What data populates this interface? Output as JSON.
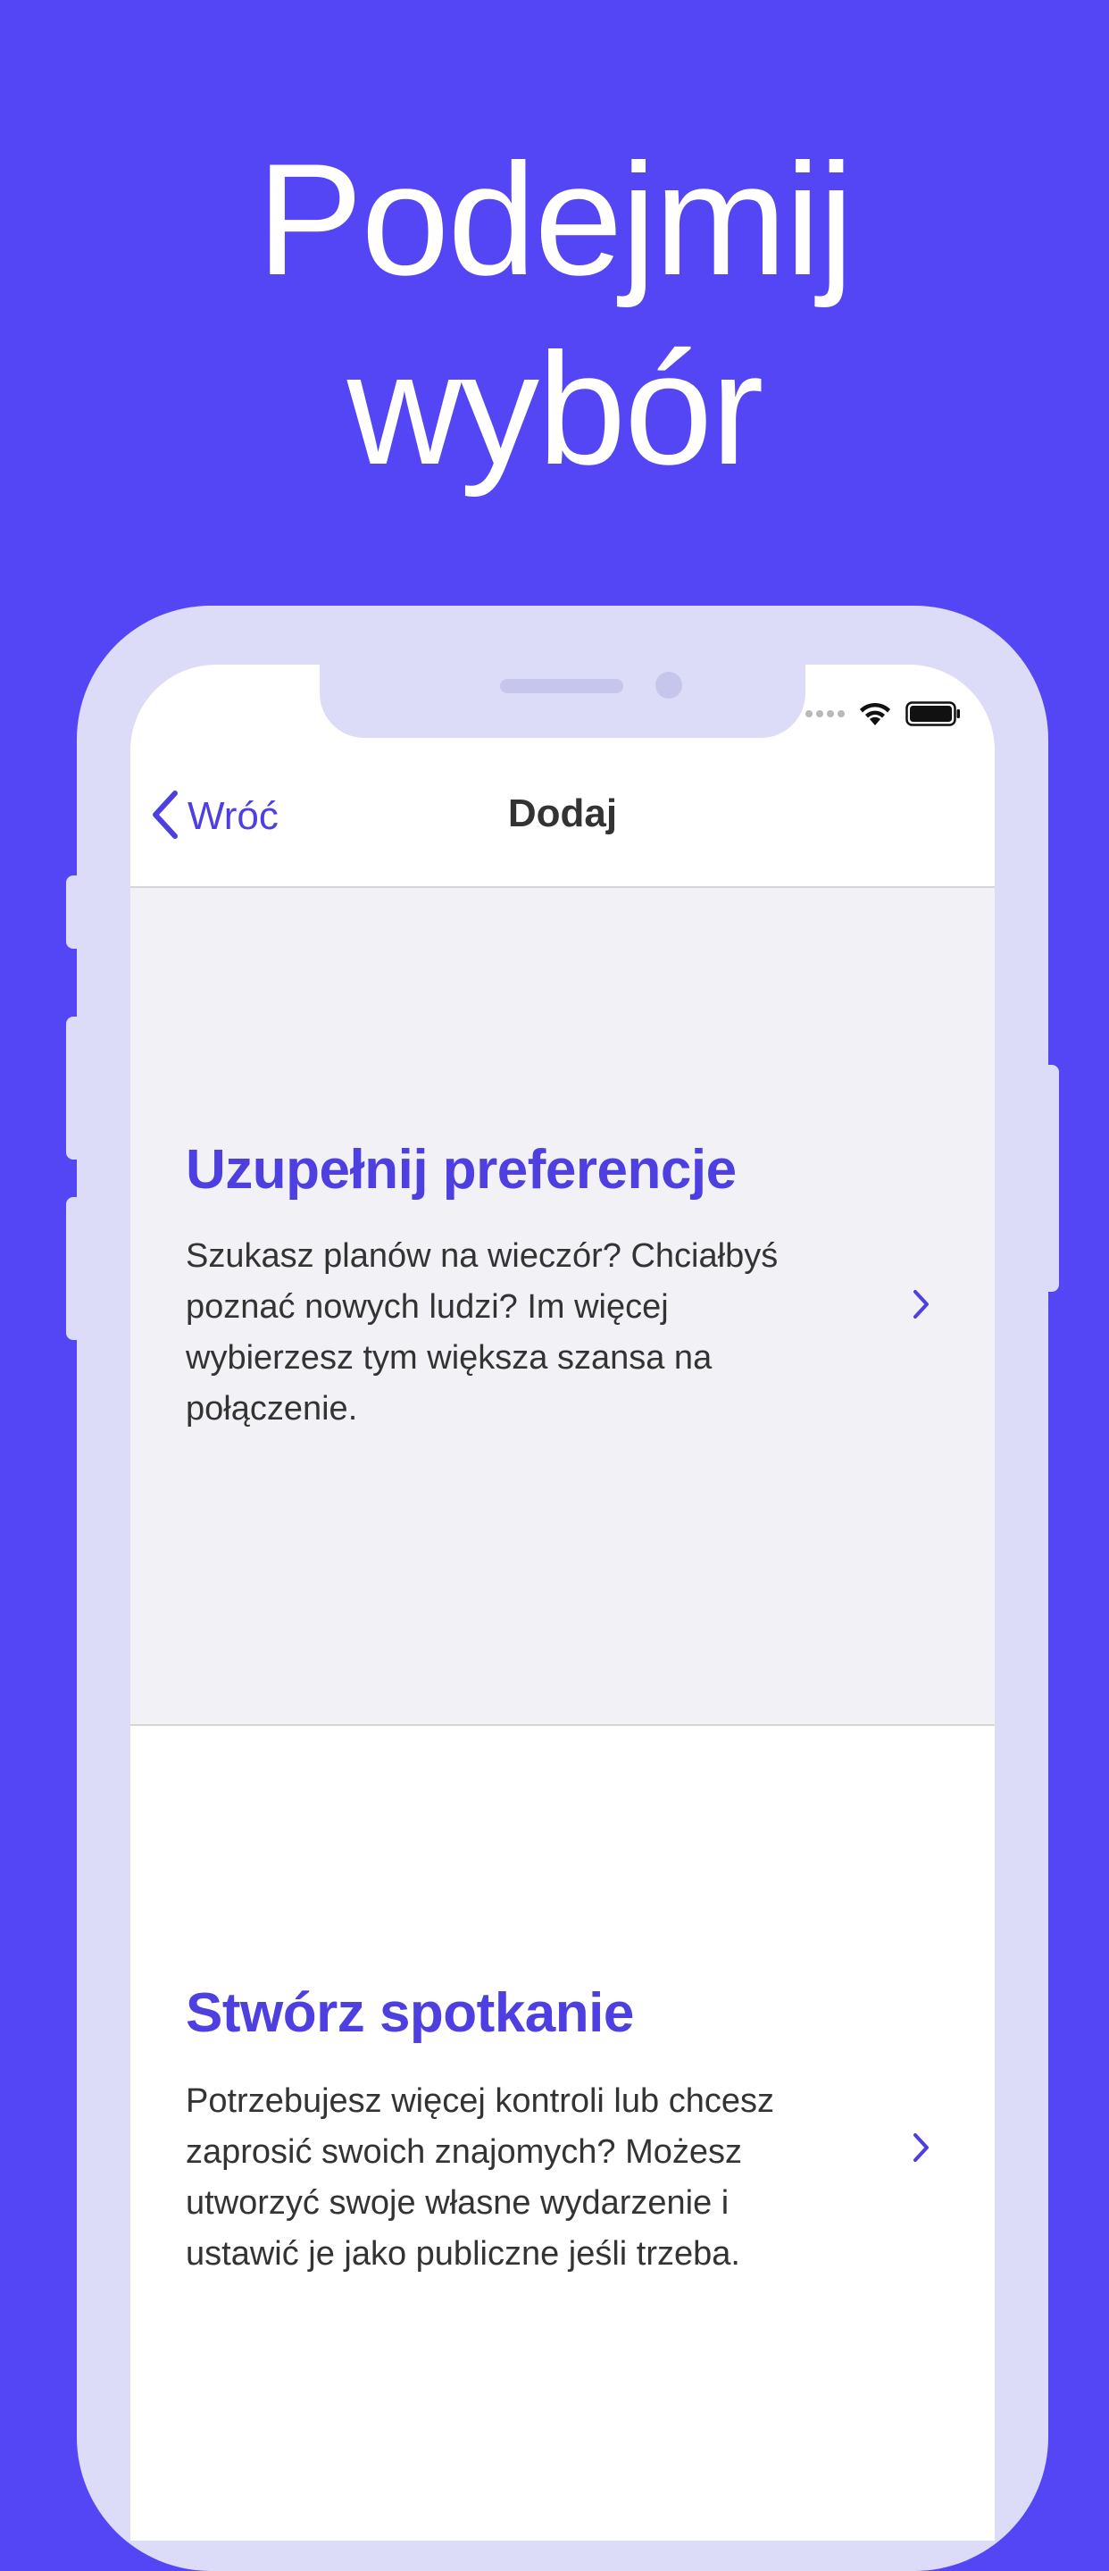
{
  "headline": {
    "line1": "Podejmij",
    "line2": "wybór"
  },
  "colors": {
    "background": "#5446f4",
    "accent": "#4d3fe0",
    "frame": "#dddcf8"
  },
  "status_bar": {
    "icons": [
      "cellular-signal-icon",
      "wifi-icon",
      "battery-icon"
    ]
  },
  "navbar": {
    "back_label": "Wróć",
    "title": "Dodaj"
  },
  "cards": [
    {
      "title": "Uzupełnij preferencje",
      "text": "Szukasz planów na wieczór? Chciałbyś poznać nowych ludzi? Im więcej wybierzesz tym większa szansa na połączenie."
    },
    {
      "title": "Stwórz spotkanie",
      "text": "Potrzebujesz więcej kontroli lub chcesz zaprosić swoich znajomych? Możesz utworzyć swoje własne wydarzenie i ustawić je jako publiczne jeśli trzeba."
    }
  ]
}
